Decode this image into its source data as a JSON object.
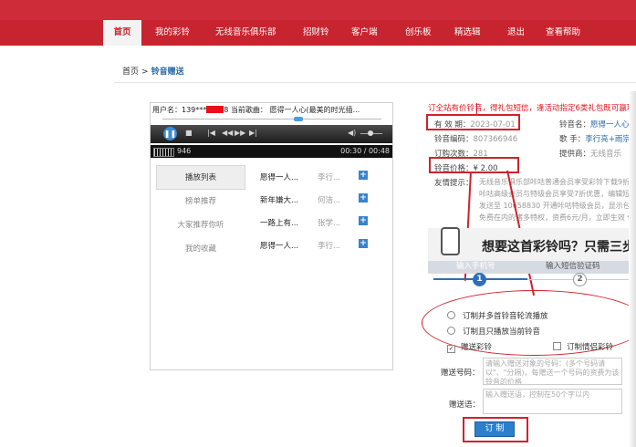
{
  "nav": {
    "items": [
      "首页",
      "我的彩铃",
      "无线音乐俱乐部",
      "招财铃",
      "客户端",
      "创乐板",
      "精选辑",
      "退出",
      "查看帮助"
    ]
  },
  "breadcrumb": {
    "home": "首页",
    "sep": ">",
    "current": "铃音赠送"
  },
  "player": {
    "header_user_label": "用户名：",
    "header_user_prefix": "139***",
    "header_user_suffix": "8",
    "header_song_label": " 当前歌曲：",
    "header_song": "愿得一人心(最美的时光插...",
    "track_no": "946",
    "time": "00:30 / 00:48",
    "tabs": [
      "播放列表",
      "榜单推荐",
      "大家推荐你听",
      "我的收藏"
    ],
    "songs": [
      {
        "title": "愿得一人...",
        "artist": "李行..."
      },
      {
        "title": "新年嫌大...",
        "artist": "何洁..."
      },
      {
        "title": "一路上有...",
        "artist": "张学..."
      },
      {
        "title": "愿得一人...",
        "artist": "李行..."
      }
    ],
    "add_glyph": "+"
  },
  "info": {
    "promo": "订全站有价铃音，得礼包短信，逢活动指定6类礼包既可赢取",
    "valid_label": "有 效 期：",
    "valid_value": "2023-07-01",
    "ring_name_label": "铃音名：",
    "ring_name_value": "愿得一人心(最",
    "code_label": "铃音编码：",
    "code_value": "807366946",
    "singer_label": "歌  手：",
    "singer_value": "李行亮+雨宗...",
    "times_label": "订购次数：",
    "times_value": "281",
    "provider_label": "提供商：",
    "provider_value": "无线音乐",
    "price_label": "铃音价格：",
    "price_value": "¥ 2.00",
    "tip_label": "友情提示：",
    "tips": [
      "无线音乐俱乐部咔咕普通会员享受彩铃下载9折",
      "咔咕高级会员与特级会员享受7折优惠，编辑短",
      "发送至 10658830 开通咔咕特级会员，显示包括",
      "免费在内的诸多特权，资费6元/月，立即生效 仅"
    ]
  },
  "order": {
    "question": "想要这首彩铃吗？只需三步",
    "step1_label": "输入手机号",
    "step2_label": "输入短信验证码",
    "step1_num": "1",
    "step2_num": "2",
    "opt1": "订制并多首铃音轮流播放",
    "opt2": "订制且只播放当前铃音",
    "gift_label": "赠送彩铃",
    "love_label": "订制情侣彩铃",
    "check_mark": "✓",
    "recipient_label": "赠送号码：",
    "recipient_placeholder": "请输入赠送对象的号码：(多个号码请以\"、\"分隔)，每赠送一个号码的资费为该铃音的价格",
    "message_label": "赠送语：",
    "message_placeholder": "输入赠送语，控制在50个字以内",
    "submit_label": "订 制"
  }
}
